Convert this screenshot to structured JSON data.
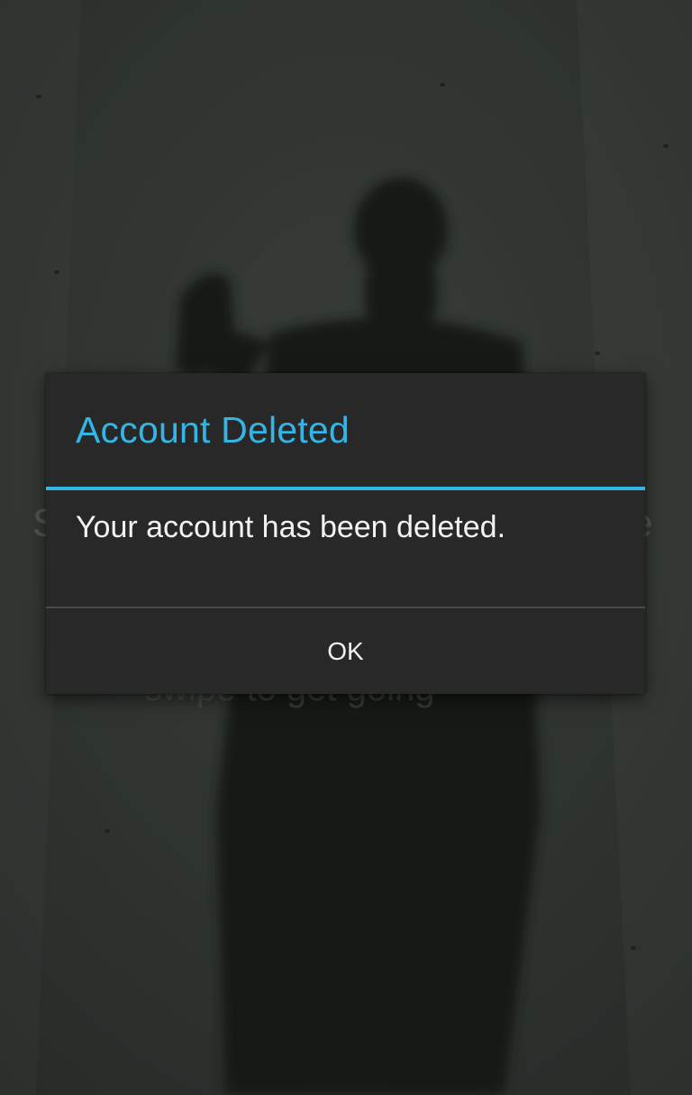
{
  "background": {
    "partial_text_left": "S",
    "partial_text_right": "e",
    "partial_text_under": "swipe to get going"
  },
  "dialog": {
    "title": "Account Deleted",
    "message": "Your account has been deleted.",
    "ok_label": "OK"
  },
  "colors": {
    "accent": "#33b5e5",
    "dialog_bg": "#282828",
    "text_primary": "#f2f2f2"
  }
}
